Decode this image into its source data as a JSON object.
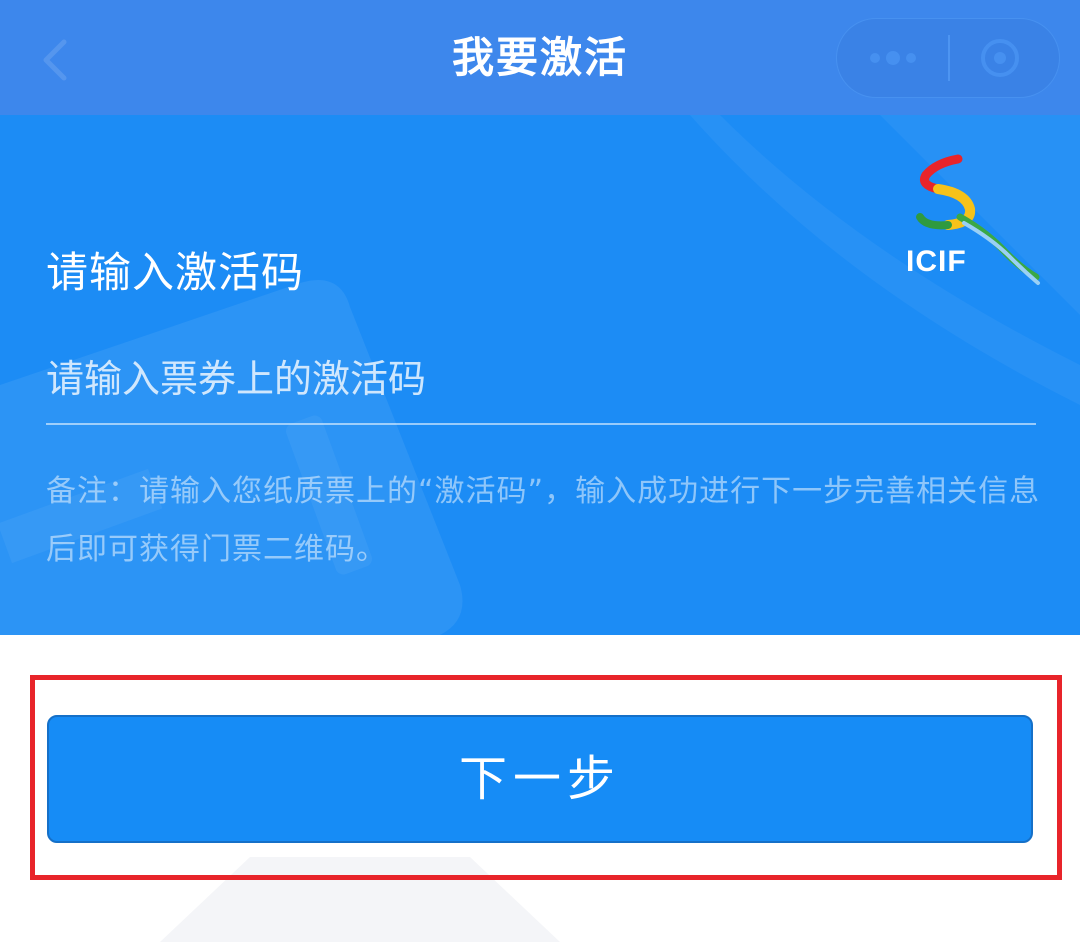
{
  "navbar": {
    "title": "我要激活",
    "background_color": "#3d87ec",
    "back_icon": "chevron-left-icon",
    "capsule": {
      "more_icon": "more-dots-icon",
      "close_icon": "close-circle-icon"
    }
  },
  "hero": {
    "background_color": "#1c8cf5",
    "logo_text": "ICIF",
    "section_label": "请输入激活码",
    "code_input": {
      "value": "",
      "placeholder": "请输入票券上的激活码"
    },
    "note": "备注：请输入您纸质票上的“激活码”，输入成功进行下一步完善相关信息后即可获得门票二维码。"
  },
  "actions": {
    "next_label": "下一步",
    "next_color": "#168cf6",
    "highlight_color": "#e8242a"
  }
}
